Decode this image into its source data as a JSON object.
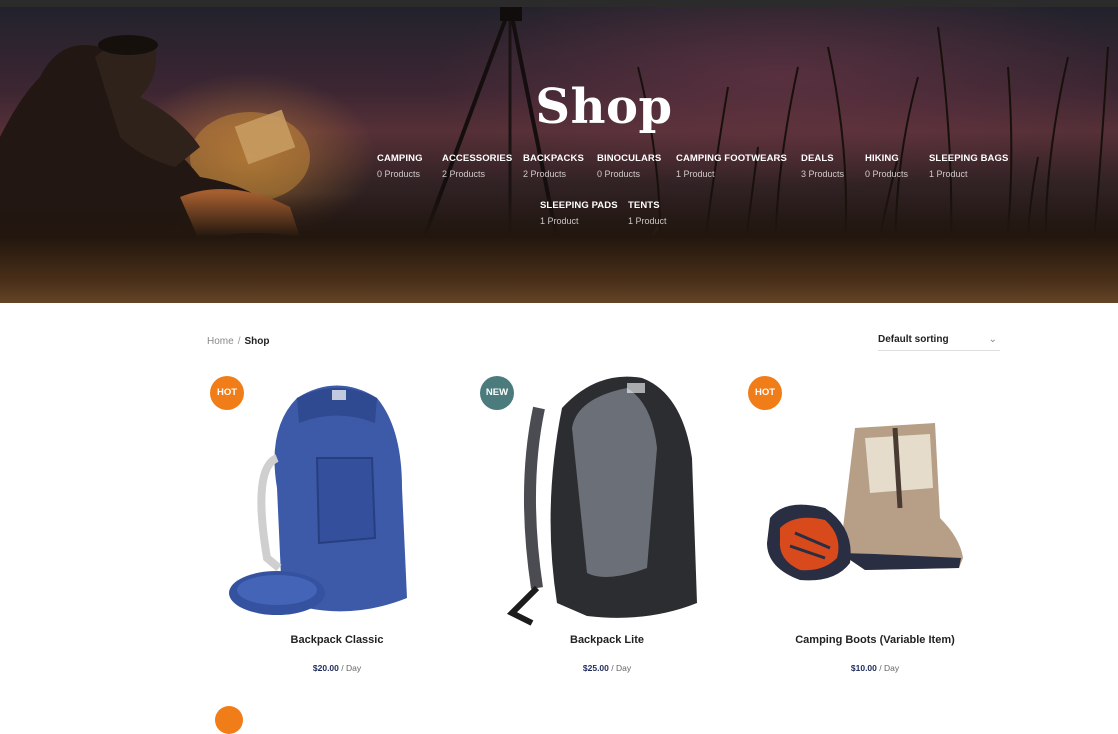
{
  "hero": {
    "title": "Shop",
    "categories": [
      {
        "name": "CAMPING",
        "count": "0 Products"
      },
      {
        "name": "ACCESSORIES",
        "count": "2 Products"
      },
      {
        "name": "BACKPACKS",
        "count": "2 Products"
      },
      {
        "name": "BINOCULARS",
        "count": "0 Products"
      },
      {
        "name": "CAMPING FOOTWEARS",
        "count": "1 Product"
      },
      {
        "name": "DEALS",
        "count": "3 Products"
      },
      {
        "name": "HIKING",
        "count": "0 Products"
      },
      {
        "name": "SLEEPING BAGS",
        "count": "1 Product"
      },
      {
        "name": "SLEEPING PADS",
        "count": "1 Product"
      },
      {
        "name": "TENTS",
        "count": "1 Product"
      }
    ]
  },
  "breadcrumb": {
    "home": "Home",
    "separator": "/",
    "current": "Shop"
  },
  "sorting": {
    "selected": "Default sorting",
    "icon": "chevron-down-icon"
  },
  "colors": {
    "hot_badge": "#f07d18",
    "new_badge": "#4b7b7d",
    "price": "#1f2b5c"
  },
  "products": [
    {
      "badge": "HOT",
      "title": "Backpack Classic",
      "price": "$20.00",
      "unit": " / Day"
    },
    {
      "badge": "NEW",
      "title": "Backpack Lite",
      "price": "$25.00",
      "unit": " / Day"
    },
    {
      "badge": "HOT",
      "title": "Camping Boots (Variable Item)",
      "price": "$10.00",
      "unit": " / Day"
    }
  ]
}
